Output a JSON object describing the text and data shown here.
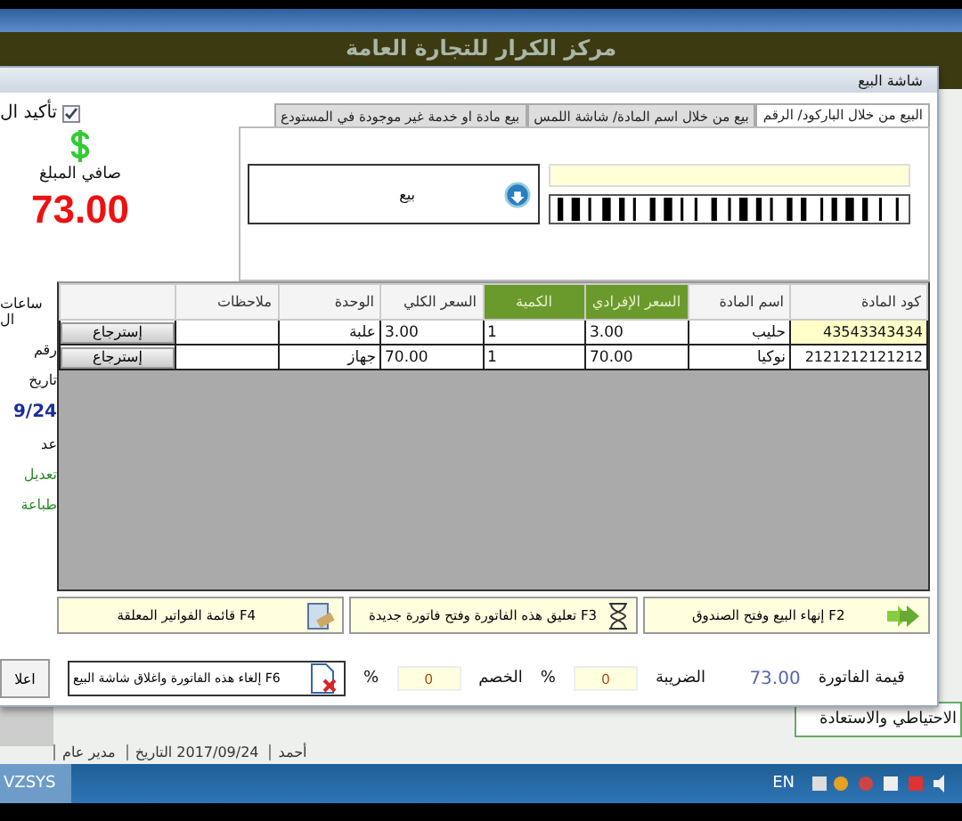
{
  "background": {
    "title": "مركز الكرار للتجارة العامة",
    "side_panel_text": "الاحتياطي والاستعادة",
    "status_bar": [
      "أحمد",
      "2017/09/24 التاريخ",
      "مدير عام"
    ]
  },
  "dialog": {
    "title": "شاشة البيع",
    "tabs": [
      {
        "label": "البيع من خلال الباركود/ الرقم",
        "selected": true
      },
      {
        "label": "بيع من خلال اسم المادة/ شاشة اللمس",
        "selected": false
      },
      {
        "label": "بيع مادة او خدمة غير موجودة في المستودع",
        "selected": false
      }
    ],
    "sale_button": "بيع",
    "left_panel": {
      "confirm": {
        "label": "تأكيد ال",
        "checked": true
      },
      "net_label": "صافي المبلغ",
      "net_amount": "73.00",
      "items": [
        {
          "text": "ساعات ال",
          "kind": "label"
        },
        {
          "text": "رقم",
          "kind": "label"
        },
        {
          "text": "تاريخ",
          "kind": "label"
        },
        {
          "text": "9/24",
          "kind": "date"
        },
        {
          "text": "عد",
          "kind": "label"
        },
        {
          "text": "تعديل",
          "kind": "link"
        },
        {
          "text": "طباعة",
          "kind": "link"
        }
      ]
    },
    "table": {
      "columns": [
        {
          "label": "كود المادة",
          "highlighted": false
        },
        {
          "label": "اسم المادة",
          "highlighted": false
        },
        {
          "label": "السعر الإفرادي",
          "highlighted": true
        },
        {
          "label": "الكمية",
          "highlighted": true
        },
        {
          "label": "السعر الكلي",
          "highlighted": false
        },
        {
          "label": "الوحدة",
          "highlighted": false
        },
        {
          "label": "ملاحظات",
          "highlighted": false
        }
      ],
      "rows": [
        {
          "cells": [
            "43543343434",
            "حليب",
            "3.00",
            "1",
            "3.00",
            "علبة",
            ""
          ],
          "action": "إسترجاع",
          "selected": true
        },
        {
          "cells": [
            "2121212121212",
            "نوكيا",
            "70.00",
            "1",
            "70.00",
            "جهاز",
            ""
          ],
          "action": "إسترجاع",
          "selected": false
        }
      ]
    },
    "actions": [
      {
        "label": "إنهاء البيع وفتح الصندوق F2",
        "kind": "finish"
      },
      {
        "label": "تعليق هذه الفاتورة وفتح فاتورة جديدة F3",
        "kind": "suspend"
      },
      {
        "label": "قائمة الفواتير المعلقة F4",
        "kind": "list"
      }
    ],
    "invoice_value_label": "قيمة الفاتورة",
    "invoice_value": "73.00",
    "tax": {
      "label": "الضريبة",
      "value": "0",
      "unit": "%"
    },
    "discount": {
      "label": "الخصم",
      "value": "0",
      "unit": "%"
    },
    "cancel_button": "إلغاء هذه الفاتورة واغلاق شاشة البيع F6",
    "cut_button": "اعلا"
  },
  "taskbar": {
    "app": "VZSYS",
    "language": "EN"
  }
}
